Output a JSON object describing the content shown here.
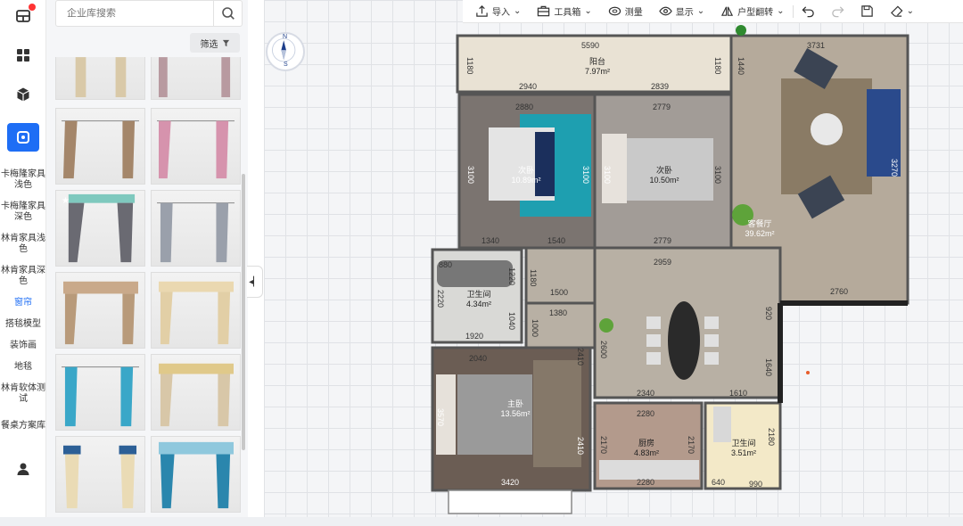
{
  "rail": {
    "icons": [
      "layout-icon",
      "grid-icon",
      "cube-icon",
      "decor-icon",
      "user-icon"
    ]
  },
  "categories": [
    {
      "label": "卡梅隆家具浅色",
      "active": false
    },
    {
      "label": "卡梅隆家具深色",
      "active": false
    },
    {
      "label": "林肯家具浅色",
      "active": false
    },
    {
      "label": "林肯家具深色",
      "active": false
    },
    {
      "label": "窗帘",
      "active": true
    },
    {
      "label": "搭毯模型",
      "active": false
    },
    {
      "label": "装饰画",
      "active": false
    },
    {
      "label": "地毯",
      "active": false
    },
    {
      "label": "林肯软体测试",
      "active": false
    },
    {
      "label": "餐桌方案库",
      "active": false
    }
  ],
  "library": {
    "search_placeholder": "企业库搜索",
    "filter_label": "筛选"
  },
  "toolbar": {
    "import": "导入",
    "toolbox": "工具箱",
    "measure": "测量",
    "display": "显示",
    "flip": "户型翻转"
  },
  "compass": {
    "n": "N",
    "s": "S"
  },
  "plan": {
    "dims": {
      "top_total": "5590",
      "top_right": "3731",
      "balcony_left_v": "1180",
      "balcony_right_v": "1180",
      "balcony_far_v": "1440",
      "balcony_bottom_a": "2940",
      "balcony_bottom_b": "2839",
      "bed2_top": "2880",
      "bed3_top": "2779",
      "bed2_left_v": "3100",
      "bed2_right_v": "3100",
      "bed3_right_v": "3100",
      "bed3_far_v": "3100",
      "bed2_bottom_a": "1340",
      "bed2_bottom_b": "1540",
      "bed3_bottom": "2779",
      "mid_width": "2959",
      "living_right_v": "3270",
      "bath1_top": "880",
      "bath1_left_v": "2220",
      "bath1_mid_v": "1220",
      "bath1_right_v": "1040",
      "bath1_bottom": "1920",
      "hall_v": "1180",
      "hall_h": "1500",
      "hall2_h": "1380",
      "hall2_v": "1000",
      "master_top": "2040",
      "master_right_v": "2410",
      "master_left_v": "3570",
      "master_bottom": "3420",
      "master_right_v2": "2410",
      "dining_v": "2600",
      "dining_right_v": "920",
      "dining_right_v2": "1640",
      "right_bottom": "2760",
      "dining_bottom_a": "2340",
      "dining_bottom_b": "1610",
      "kitchen_top": "2280",
      "kitchen_bottom": "2280",
      "kitchen_left_v": "2170",
      "kitchen_right_v": "2170",
      "bath2_right_v": "2180",
      "bath2_bottom_a": "640",
      "bath2_bottom_b": "990"
    },
    "rooms": {
      "balcony": {
        "name": "阳台",
        "area": "7.97m²"
      },
      "bed2": {
        "name": "次卧",
        "area": "10.89m²"
      },
      "bed3": {
        "name": "次卧",
        "area": "10.50m²"
      },
      "living": {
        "name": "客餐厅",
        "area": "39.62m²"
      },
      "bath1": {
        "name": "卫生间",
        "area": "4.34m²"
      },
      "master": {
        "name": "主卧",
        "area": "13.56m²"
      },
      "kitchen": {
        "name": "厨房",
        "area": "4.83m²"
      },
      "bath2": {
        "name": "卫生间",
        "area": "3.51m²"
      }
    }
  },
  "colors": {
    "accent": "#1e6ef5",
    "wall": "#4a4a4a"
  }
}
